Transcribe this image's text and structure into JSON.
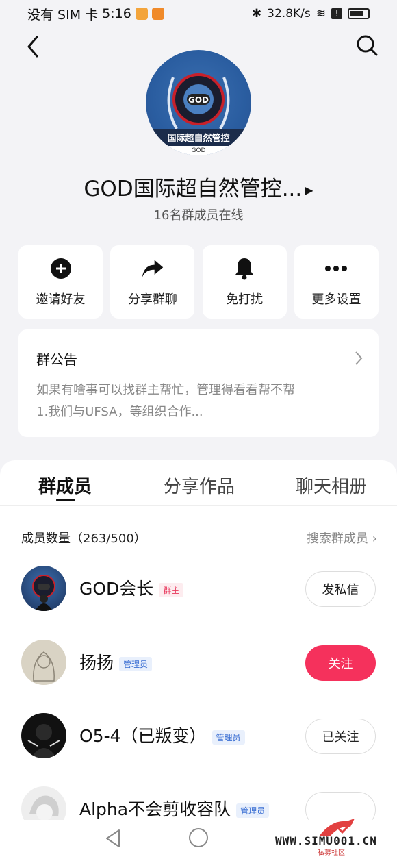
{
  "status": {
    "carrier": "没有 SIM 卡",
    "time": "5:16",
    "net_speed": "32.8K/s"
  },
  "header": {
    "group_name": "GOD国际超自然管控...",
    "online_text": "16名群成员在线",
    "avatar_banner": "国际超自然管控",
    "avatar_sub": "GOD"
  },
  "actions": [
    {
      "label": "邀请好友",
      "icon": "plus-circle-icon"
    },
    {
      "label": "分享群聊",
      "icon": "share-arrow-icon"
    },
    {
      "label": "免打扰",
      "icon": "bell-icon"
    },
    {
      "label": "更多设置",
      "icon": "more-dots-icon"
    }
  ],
  "notice": {
    "title": "群公告",
    "line1": "如果有啥事可以找群主帮忙，管理得看看帮不帮",
    "line2": "1.我们与UFSA，等组织合作..."
  },
  "tabs": [
    {
      "label": "群成员",
      "active": true
    },
    {
      "label": "分享作品",
      "active": false
    },
    {
      "label": "聊天相册",
      "active": false
    }
  ],
  "members": {
    "count_label": "成员数量（263/500）",
    "search_label": "搜索群成员",
    "list": [
      {
        "name": "GOD会长",
        "role": "群主",
        "button": "发私信"
      },
      {
        "name": "扬扬",
        "role": "管理员",
        "button": "关注"
      },
      {
        "name": "O5-4（已叛变）",
        "role": "管理员",
        "button": "已关注"
      },
      {
        "name": "Alpha不会剪收容队",
        "role": "管理员",
        "button": ""
      }
    ]
  },
  "watermark": {
    "text": "WWW.SIMU001.CN",
    "sub": "私募社区"
  },
  "colors": {
    "accent": "#f5315c",
    "owner_tag": "#e83a5e",
    "admin_tag": "#3b6fd3",
    "background": "#f3f3f6"
  }
}
